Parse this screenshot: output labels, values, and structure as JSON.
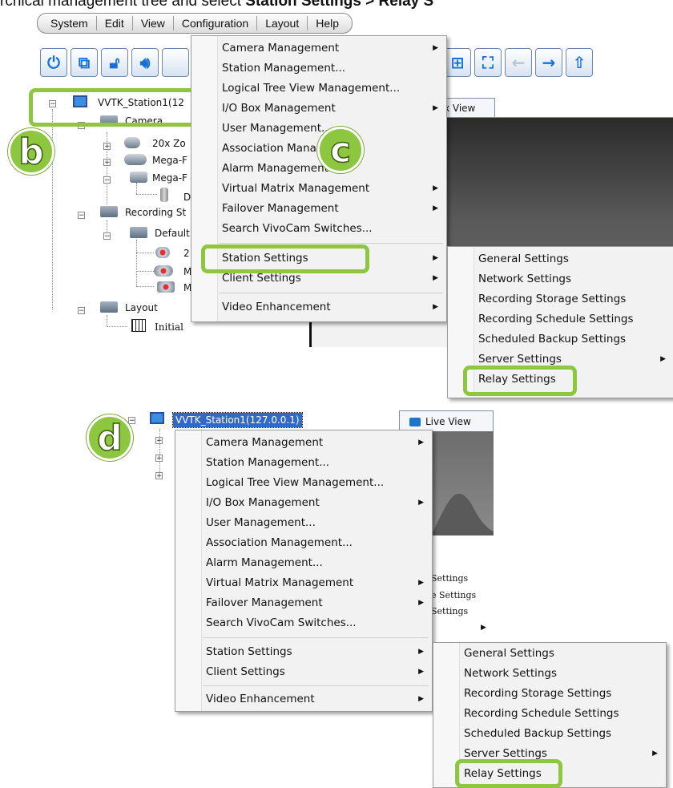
{
  "instruction": {
    "prefix": "rchical management tree and select ",
    "bold": "Station Settings > Relay S"
  },
  "menubar": [
    "System",
    "Edit",
    "View",
    "Configuration",
    "Layout",
    "Help"
  ],
  "colors": {
    "accent": "#8dc63f",
    "selection": "#3169c6"
  },
  "top": {
    "tree": {
      "station": "VVTK_Station1(12",
      "camera_folder": "Camera",
      "cam1": "20x Zo",
      "cam2": "Mega-F",
      "cam3": "Mega-F",
      "cam3_child": "D",
      "recording": "Recording St",
      "default": "Default",
      "rec1": "2",
      "rec2": "M",
      "rec3": "M",
      "layout": "Layout",
      "initial": "Initial"
    },
    "tab_label": "trix View",
    "badge_b": "b",
    "badge_c": "c",
    "context_menu": [
      {
        "label": "Camera Management",
        "sub": true
      },
      {
        "label": "Station Management...",
        "sub": false
      },
      {
        "label": "Logical Tree View Management...",
        "sub": false
      },
      {
        "label": "I/O Box Management",
        "sub": true
      },
      {
        "label": "User Management...",
        "sub": false
      },
      {
        "label": "Association Manag",
        "sub": false
      },
      {
        "label": "Alarm Management",
        "sub": false
      },
      {
        "label": "Virtual Matrix Management",
        "sub": true
      },
      {
        "label": "Failover Management",
        "sub": true
      },
      {
        "label": "Search VivoCam Switches...",
        "sub": false
      },
      {
        "label": "Station Settings",
        "sub": true
      },
      {
        "label": "Client Settings",
        "sub": true
      },
      {
        "label": "Video Enhancement",
        "sub": true
      }
    ],
    "submenu": [
      {
        "label": "General Settings",
        "sub": false
      },
      {
        "label": "Network Settings",
        "sub": false
      },
      {
        "label": "Recording Storage Settings",
        "sub": false
      },
      {
        "label": "Recording Schedule Settings",
        "sub": false
      },
      {
        "label": "Scheduled Backup Settings",
        "sub": false
      },
      {
        "label": "Server Settings",
        "sub": true
      },
      {
        "label": "Relay Settings",
        "sub": false
      }
    ]
  },
  "bottom": {
    "badge_d": "d",
    "station": "VVTK_Station1(127.0.0.1)",
    "tab_label": "Live View",
    "bg_fragments": [
      "Settings",
      "e Settings",
      "Settings"
    ],
    "context_menu": [
      {
        "label": "Camera Management",
        "sub": true
      },
      {
        "label": "Station Management...",
        "sub": false
      },
      {
        "label": "Logical Tree View Management...",
        "sub": false
      },
      {
        "label": "I/O Box Management",
        "sub": true
      },
      {
        "label": "User Management...",
        "sub": false
      },
      {
        "label": "Association Management...",
        "sub": false
      },
      {
        "label": "Alarm Management...",
        "sub": false
      },
      {
        "label": "Virtual Matrix Management",
        "sub": true
      },
      {
        "label": "Failover Management",
        "sub": true
      },
      {
        "label": "Search VivoCam Switches...",
        "sub": false
      },
      {
        "label": "Station Settings",
        "sub": true
      },
      {
        "label": "Client Settings",
        "sub": true
      },
      {
        "label": "Video Enhancement",
        "sub": true
      }
    ],
    "submenu": [
      {
        "label": "General Settings",
        "sub": false
      },
      {
        "label": "Network Settings",
        "sub": false
      },
      {
        "label": "Recording Storage Settings",
        "sub": false
      },
      {
        "label": "Recording Schedule Settings",
        "sub": false
      },
      {
        "label": "Scheduled Backup Settings",
        "sub": false
      },
      {
        "label": "Server Settings",
        "sub": true
      },
      {
        "label": "Relay Settings",
        "sub": false
      }
    ]
  }
}
